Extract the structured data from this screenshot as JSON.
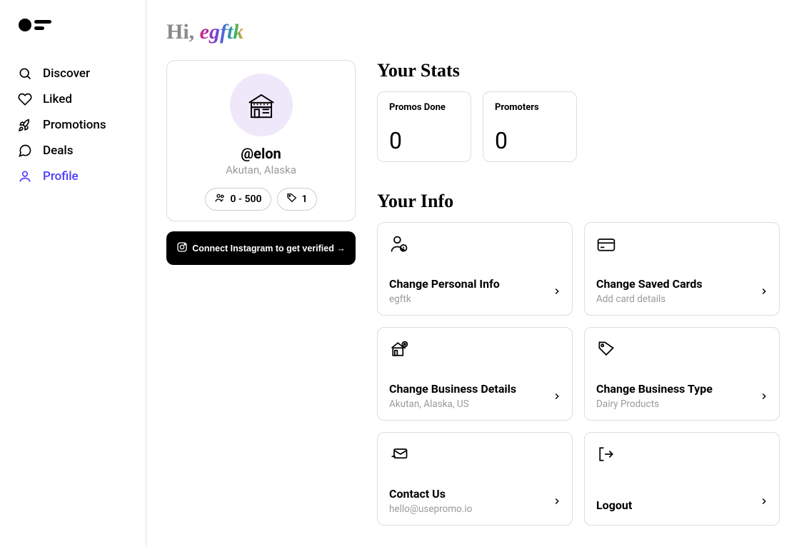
{
  "sidebar": {
    "items": [
      {
        "label": "Discover"
      },
      {
        "label": "Liked"
      },
      {
        "label": "Promotions"
      },
      {
        "label": "Deals"
      },
      {
        "label": "Profile"
      }
    ]
  },
  "greeting": {
    "prefix": "Hi, ",
    "name": "egftk"
  },
  "profile": {
    "handle": "@elon",
    "location": "Akutan, Alaska",
    "followers_range": "0 - 500",
    "tags_count": "1",
    "connect_label": "Connect Instagram to get verified →"
  },
  "stats": {
    "title": "Your Stats",
    "cards": [
      {
        "label": "Promos Done",
        "value": "0"
      },
      {
        "label": "Promoters",
        "value": "0"
      }
    ]
  },
  "info": {
    "title": "Your Info",
    "cards": [
      {
        "title": "Change Personal Info",
        "sub": "egftk"
      },
      {
        "title": "Change Saved Cards",
        "sub": "Add card details"
      },
      {
        "title": "Change Business Details",
        "sub": "Akutan, Alaska, US"
      },
      {
        "title": "Change Business Type",
        "sub": "Dairy Products"
      },
      {
        "title": "Contact Us",
        "sub": "hello@usepromo.io"
      },
      {
        "title": "Logout",
        "sub": ""
      }
    ]
  }
}
